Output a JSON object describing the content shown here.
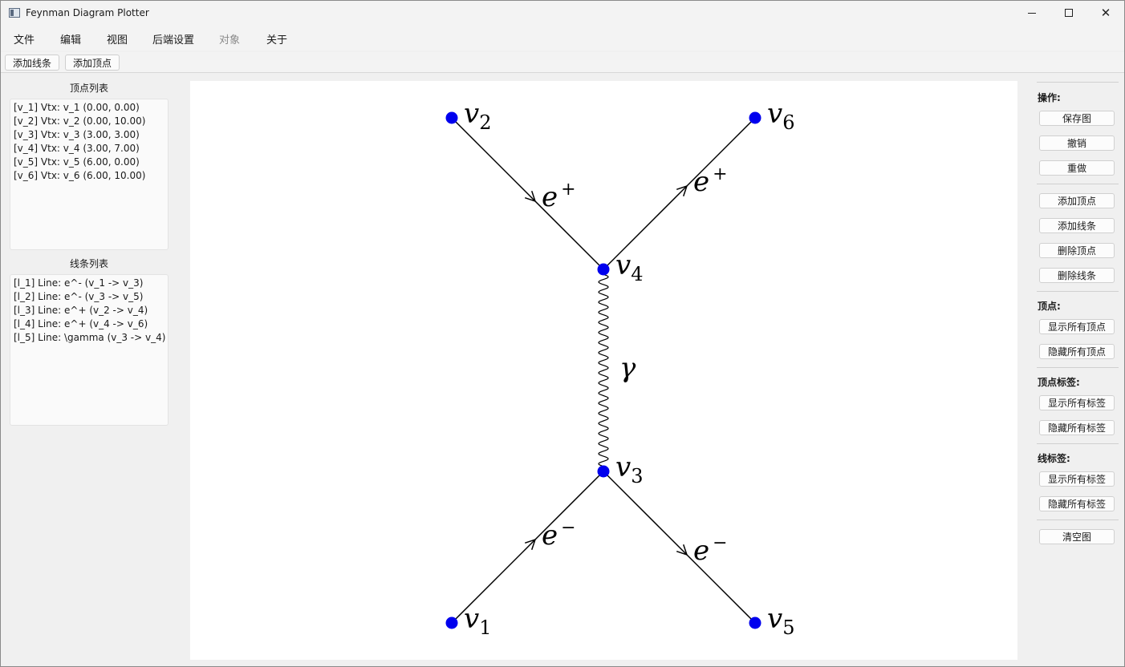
{
  "window": {
    "title": "Feynman Diagram Plotter"
  },
  "menu": [
    "文件",
    "编辑",
    "视图",
    "后端设置",
    "对象",
    "关于"
  ],
  "toolbar": {
    "add_line": "添加线条",
    "add_vertex": "添加顶点"
  },
  "vertex_list": {
    "title": "顶点列表",
    "items": [
      "[v_1] Vtx: v_1 (0.00, 0.00)",
      "[v_2] Vtx: v_2 (0.00, 10.00)",
      "[v_3] Vtx: v_3 (3.00, 3.00)",
      "[v_4] Vtx: v_4 (3.00, 7.00)",
      "[v_5] Vtx: v_5 (6.00, 0.00)",
      "[v_6] Vtx: v_6 (6.00, 10.00)"
    ]
  },
  "line_list": {
    "title": "线条列表",
    "items": [
      "[l_1] Line: e^- (v_1 -> v_3)",
      "[l_2] Line: e^- (v_3 -> v_5)",
      "[l_3] Line: e^+ (v_2 -> v_4)",
      "[l_4] Line: e^+ (v_4 -> v_6)",
      "[l_5] Line: \\gamma (v_3 -> v_4)"
    ]
  },
  "diagram": {
    "vertex_color": "#0000ee",
    "vertices": [
      {
        "id": "v_1",
        "name": "v",
        "sub": "1",
        "x": 0,
        "y": 0
      },
      {
        "id": "v_2",
        "name": "v",
        "sub": "2",
        "x": 0,
        "y": 10
      },
      {
        "id": "v_3",
        "name": "v",
        "sub": "3",
        "x": 3,
        "y": 3
      },
      {
        "id": "v_4",
        "name": "v",
        "sub": "4",
        "x": 3,
        "y": 7
      },
      {
        "id": "v_5",
        "name": "v",
        "sub": "5",
        "x": 6,
        "y": 0
      },
      {
        "id": "v_6",
        "name": "v",
        "sub": "6",
        "x": 6,
        "y": 10
      }
    ],
    "lines": [
      {
        "id": "l_1",
        "type": "fermion",
        "from": "v_1",
        "to": "v_3",
        "label": "e",
        "sup": "−"
      },
      {
        "id": "l_2",
        "type": "fermion",
        "from": "v_3",
        "to": "v_5",
        "label": "e",
        "sup": "−"
      },
      {
        "id": "l_3",
        "type": "fermion",
        "from": "v_2",
        "to": "v_4",
        "label": "e",
        "sup": "+"
      },
      {
        "id": "l_4",
        "type": "fermion",
        "from": "v_4",
        "to": "v_6",
        "label": "e",
        "sup": "+"
      },
      {
        "id": "l_5",
        "type": "photon",
        "from": "v_3",
        "to": "v_4",
        "label": "γ",
        "sup": ""
      }
    ]
  },
  "right_panel": {
    "ops_heading": "操作:",
    "save": "保存图",
    "undo": "撤销",
    "redo": "重做",
    "add_vertex": "添加顶点",
    "add_line": "添加线条",
    "delete_vertex": "删除顶点",
    "delete_line": "删除线条",
    "vertex_heading": "顶点:",
    "show_all_vertices": "显示所有顶点",
    "hide_all_vertices": "隐藏所有顶点",
    "vertex_label_heading": "顶点标签:",
    "show_vertex_labels": "显示所有标签",
    "hide_vertex_labels": "隐藏所有标签",
    "line_label_heading": "线标签:",
    "show_line_labels": "显示所有标签",
    "hide_line_labels": "隐藏所有标签",
    "clear": "清空图"
  }
}
